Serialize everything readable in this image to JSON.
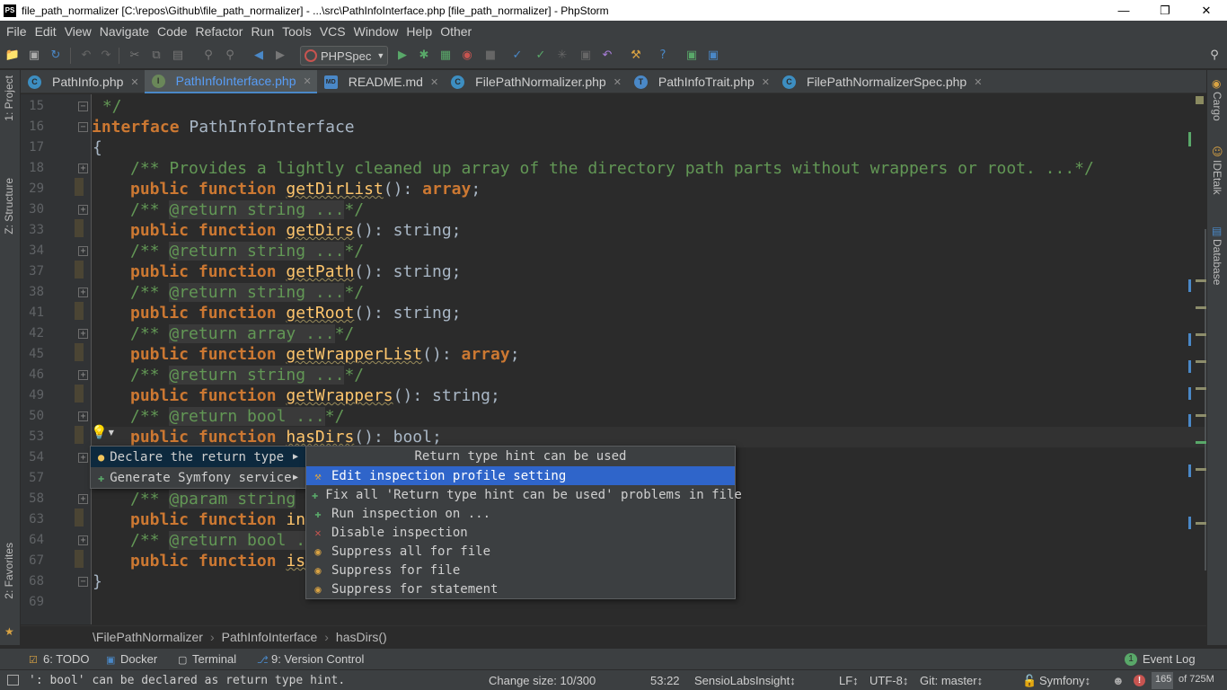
{
  "window": {
    "title": "file_path_normalizer [C:\\repos\\Github\\file_path_normalizer] - ...\\src\\PathInfoInterface.php [file_path_normalizer] - PhpStorm",
    "app_icon_text": "PS"
  },
  "menu": [
    "File",
    "Edit",
    "View",
    "Navigate",
    "Code",
    "Refactor",
    "Run",
    "Tools",
    "VCS",
    "Window",
    "Help",
    "Other"
  ],
  "toolbar": {
    "run_config": "PHPSpec"
  },
  "left_tools": {
    "project": "1: Project",
    "structure": "Z: Structure",
    "favorites": "2: Favorites"
  },
  "right_tools": {
    "cargo": "Cargo",
    "idetalk": "IDEtalk",
    "database": "Database"
  },
  "tabs": [
    {
      "label": "PathInfo.php",
      "icon": "C",
      "color": "#3d8ec1",
      "active": false
    },
    {
      "label": "PathInfoInterface.php",
      "icon": "I",
      "color": "#6a8759",
      "active": true
    },
    {
      "label": "README.md",
      "icon": "MD",
      "color": "#4a88c7",
      "active": false
    },
    {
      "label": "FilePathNormalizer.php",
      "icon": "C",
      "color": "#3d8ec1",
      "active": false
    },
    {
      "label": "PathInfoTrait.php",
      "icon": "T",
      "color": "#4a88c7",
      "active": false
    },
    {
      "label": "FilePathNormalizerSpec.php",
      "icon": "C",
      "color": "#3d8ec1",
      "active": false
    }
  ],
  "editor": {
    "line_numbers": [
      "15",
      "16",
      "17",
      "18",
      "29",
      "30",
      "33",
      "34",
      "37",
      "38",
      "41",
      "42",
      "45",
      "46",
      "49",
      "50",
      "53",
      "54",
      "57",
      "58",
      "63",
      "64",
      "67",
      "68",
      "69"
    ],
    "code": {
      "l15": " */",
      "l16_kw": "interface",
      "l16_name": " PathInfoInterface",
      "l17": "{",
      "l18": "/** Provides a lightly cleaned up array of the directory path parts without wrappers or root. ...*/",
      "kw_public": "public",
      "kw_function": "function",
      "getDirList": "getDirList",
      "getDirs": "getDirs",
      "getPath": "getPath",
      "getRoot": "getRoot",
      "getWrapperList": "getWrapperList",
      "getWrappers": "getWrappers",
      "hasDirs": "hasDirs",
      "ret_array": "(): array;",
      "ret_array_kw": "array",
      "ret_string": "(): string;",
      "ret_bool": "(): bool;",
      "doc_return_string": "@return string ...",
      "doc_return_array": "@return array ...",
      "doc_return_bool": "@return bool ...",
      "doc_param_string": "@param string",
      "doc_return_bool_short": "@return bool .",
      "in_prefix": "in",
      "is_prefix": "is",
      "doc_open": "/** ",
      "doc_close": "*/",
      "l68": "}"
    }
  },
  "intention_popup": {
    "items": [
      {
        "label": "Declare the return type",
        "icon": "bulb-icon",
        "selected": true
      },
      {
        "label": "Generate Symfony service",
        "icon": "wand-icon",
        "selected": false
      }
    ]
  },
  "submenu": {
    "title": "Return type hint can be used",
    "items": [
      {
        "label": "Edit inspection profile setting",
        "icon": "settings-icon",
        "selected": true
      },
      {
        "label": "Fix all 'Return type hint can be used' problems in file",
        "icon": "fix-icon",
        "selected": false
      },
      {
        "label": "Run inspection on ...",
        "icon": "run-icon",
        "selected": false
      },
      {
        "label": "Disable inspection",
        "icon": "close-icon",
        "selected": false
      },
      {
        "label": "Suppress all for file",
        "icon": "suppress-icon",
        "selected": false
      },
      {
        "label": "Suppress for file",
        "icon": "suppress-icon",
        "selected": false
      },
      {
        "label": "Suppress for statement",
        "icon": "suppress-icon",
        "selected": false
      }
    ]
  },
  "breadcrumb": [
    "\\FilePathNormalizer",
    "PathInfoInterface",
    "hasDirs()"
  ],
  "bottom_tools": {
    "todo": "6: TODO",
    "docker": "Docker",
    "terminal": "Terminal",
    "vcs": "9: Version Control",
    "event_log": "Event Log",
    "event_count": "1"
  },
  "status": {
    "message": "': bool' can be declared as return type hint.",
    "change_size": "Change size: 10/300",
    "position": "53:22",
    "insight": "SensioLabsInsight↕",
    "line_sep": "LF↕",
    "encoding": "UTF-8↕",
    "git": "Git: master↕",
    "framework": "Symfony↕",
    "memory_used": "165",
    "memory_total": "of 725M"
  }
}
